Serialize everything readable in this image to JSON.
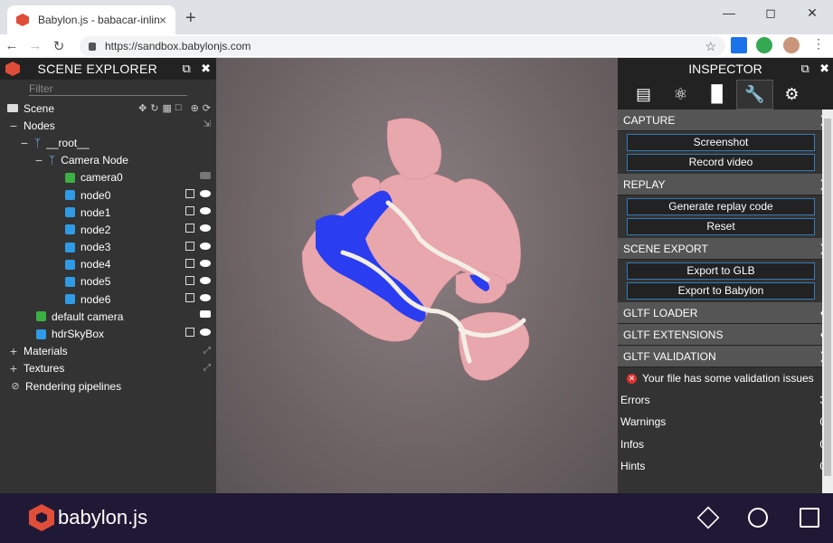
{
  "browser": {
    "tab_title": "Babylon.js - babacar-inline.gltf",
    "url": "https://sandbox.babylonjs.com",
    "new_tab": "+",
    "tab_close": "×"
  },
  "explorer": {
    "title": "SCENE EXPLORER",
    "filter_placeholder": "Filter",
    "scene_label": "Scene",
    "nodes_label": "Nodes",
    "root_label": "__root__",
    "camera_node_label": "Camera Node",
    "camera0_label": "camera0",
    "nodes": [
      "node0",
      "node1",
      "node2",
      "node3",
      "node4",
      "node5",
      "node6"
    ],
    "default_camera_label": "default camera",
    "skybox_label": "hdrSkyBox",
    "materials_label": "Materials",
    "textures_label": "Textures",
    "pipelines_label": "Rendering pipelines"
  },
  "inspector": {
    "title": "INSPECTOR",
    "sections": {
      "capture": "CAPTURE",
      "replay": "REPLAY",
      "scene_export": "SCENE EXPORT",
      "gltf_loader": "GLTF LOADER",
      "gltf_extensions": "GLTF EXTENSIONS",
      "gltf_validation": "GLTF VALIDATION"
    },
    "buttons": {
      "screenshot": "Screenshot",
      "record_video": "Record video",
      "generate_replay": "Generate replay code",
      "reset": "Reset",
      "export_glb": "Export to GLB",
      "export_babylon": "Export to Babylon"
    },
    "validation_message": "Your file has some validation issues",
    "stats": [
      {
        "label": "Errors",
        "value": "3"
      },
      {
        "label": "Warnings",
        "value": "0"
      },
      {
        "label": "Infos",
        "value": "0"
      },
      {
        "label": "Hints",
        "value": "0"
      }
    ]
  },
  "footer": {
    "brand": "babylon.js"
  },
  "colors": {
    "accent": "#e04e39",
    "panel": "#333333",
    "footer": "#201936",
    "mesh_blue": "#2a3df0",
    "mesh_pink": "#e8a6ad"
  }
}
